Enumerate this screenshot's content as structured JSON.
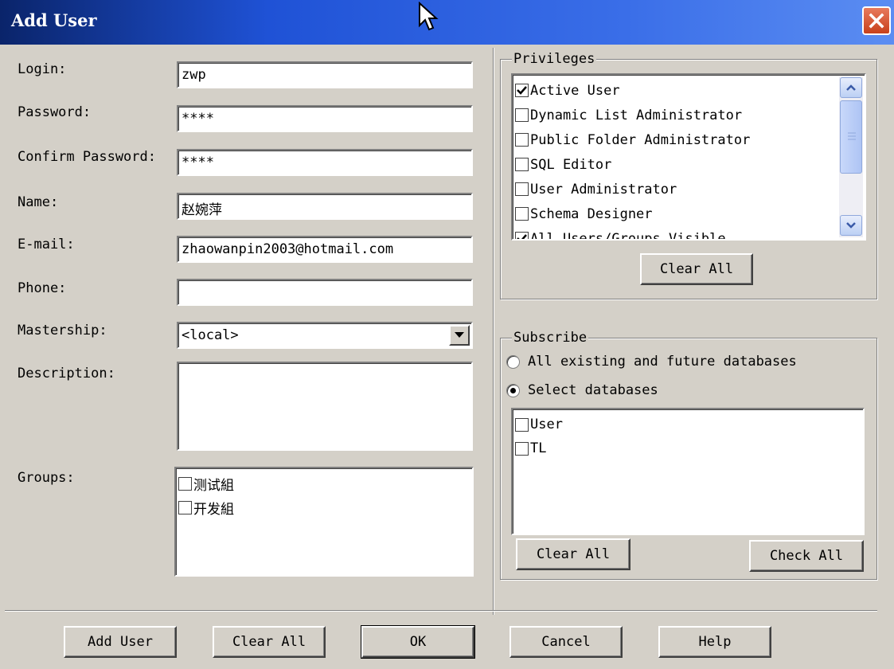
{
  "window": {
    "title": "Add User"
  },
  "form": {
    "login_label": "Login:",
    "login_value": "zwp",
    "password_label": "Password:",
    "password_value": "****",
    "confirm_label": "Confirm Password:",
    "confirm_value": "****",
    "name_label": "Name:",
    "name_value": "赵婉萍",
    "email_label": "E-mail:",
    "email_value": "zhaowanpin2003@hotmail.com",
    "phone_label": "Phone:",
    "phone_value": "",
    "mastership_label": "Mastership:",
    "mastership_value": "<local>",
    "description_label": "Description:",
    "description_value": "",
    "groups_label": "Groups:",
    "groups": [
      {
        "label": "测试組",
        "checked": false
      },
      {
        "label": "开发組",
        "checked": false
      }
    ]
  },
  "privileges": {
    "title": "Privileges",
    "items": [
      {
        "label": "Active User",
        "checked": true
      },
      {
        "label": "Dynamic List Administrator",
        "checked": false
      },
      {
        "label": "Public Folder Administrator",
        "checked": false
      },
      {
        "label": "SQL Editor",
        "checked": false
      },
      {
        "label": "User Administrator",
        "checked": false
      },
      {
        "label": "Schema Designer",
        "checked": false
      },
      {
        "label": "All Users/Groups Visible",
        "checked": true
      }
    ],
    "clear_all_label": "Clear All"
  },
  "subscribe": {
    "title": "Subscribe",
    "option_all": "All existing and future databases",
    "option_select": "Select databases",
    "selected_option": "select",
    "databases": [
      {
        "label": "User",
        "checked": false
      },
      {
        "label": "TL",
        "checked": false
      }
    ],
    "clear_all_label": "Clear All",
    "check_all_label": "Check All"
  },
  "buttons": {
    "add_user": "Add User",
    "clear_all": "Clear All",
    "ok": "OK",
    "cancel": "Cancel",
    "help": "Help"
  },
  "colors": {
    "dialog_bg": "#d4d0c8",
    "title_bar": "#0a246a",
    "close_button": "#c8411c"
  }
}
